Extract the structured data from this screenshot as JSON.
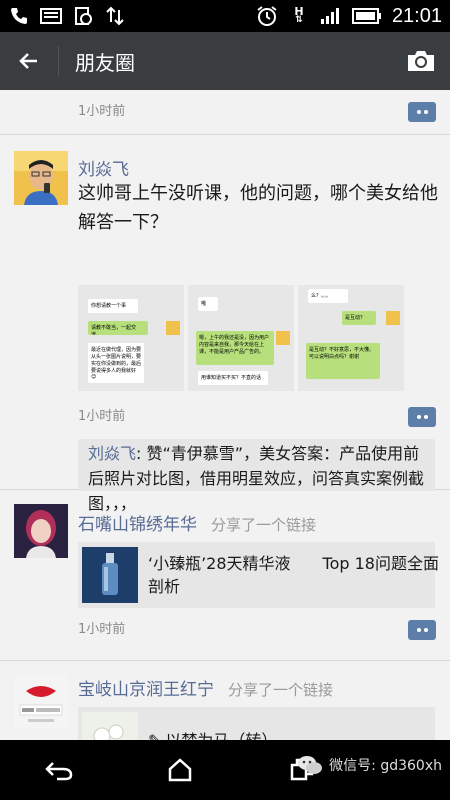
{
  "status_bar": {
    "time": "21:01",
    "network": "H",
    "icons": [
      "phone-icon",
      "message-icon",
      "sync-icon",
      "data-transfer-icon",
      "alarm-icon",
      "signal-icon",
      "battery-icon"
    ]
  },
  "header": {
    "back_icon": "back-arrow-icon",
    "title": "朋友圈",
    "camera_icon": "camera-icon"
  },
  "feed": {
    "top_time": "1小时前",
    "posts": [
      {
        "author": "刘焱飞",
        "text_line1": "这帅哥上午没听课，他的问题，哪个美女给他",
        "text_line2": "解答一下？",
        "time": "1小时前",
        "images": [
          {
            "bubble1": "你想请教一个事",
            "bubble2": "请教不敢当，一起交流。",
            "bubble3": "最近在做代理，因为要从头一张图片说明，要实在你没做到的，最后要说得多人的我就好 😊"
          },
          {
            "bubble1": "哦",
            "bubble2": "嗯，上午的我还是没，因为用户内容是来自我，那今天给在上课，不能是用户产品广告的。",
            "bubble3": "用谁知道买不买？不直的话"
          },
          {
            "bubble1": "么？。。。",
            "bubble2": "是互动？",
            "bubble3": "是互动？不好意思，不大懂。可以说明白点吗？谢谢"
          }
        ],
        "likes_name": "刘焱飞",
        "likes_line1": ": 赞“青伊慕雪”，美女答案：产品使用前",
        "likes_line2": "后照片对比图，借用明星效应，问答真实案例截",
        "likes_line3": "图，，，"
      },
      {
        "author": "石嘴山锦绣年华",
        "shared": "分享了一个链接",
        "link_line1": "‘小臻瓶’28天精华液　　Top 18问题全面",
        "link_line2": "剖析",
        "time": "1小时前"
      },
      {
        "author": "宝岐山京润王红宁",
        "shared": "分享了一个链接",
        "link_title": "以梦为马（转）"
      }
    ]
  },
  "nav_bar": {
    "back_icon": "nav-back-icon",
    "home_icon": "nav-home-icon",
    "recent_icon": "nav-recent-apps-icon"
  },
  "watermark": "微信号: gd360xh"
}
